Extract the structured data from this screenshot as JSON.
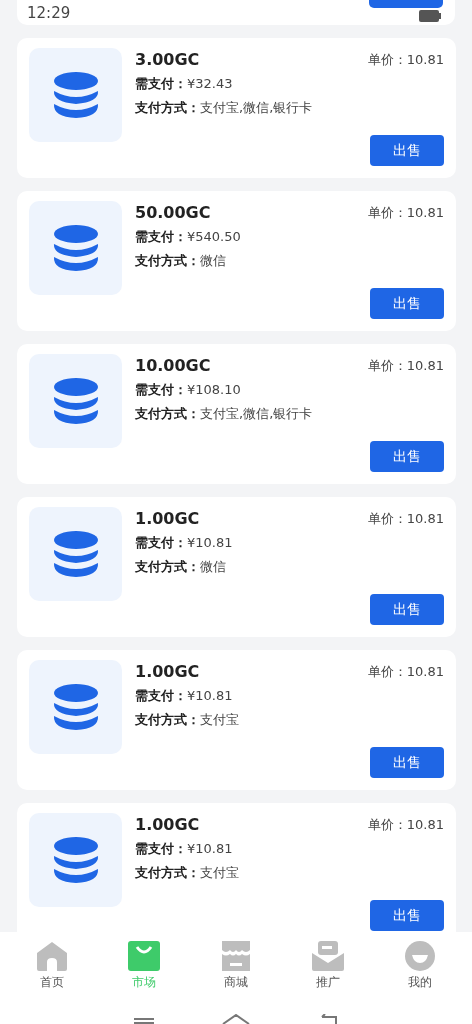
{
  "status_bar": {
    "time": "12:29"
  },
  "orders": [
    {
      "amount": "3.00GC",
      "unit_price": "单价：10.81",
      "payment": "**需支付：**¥32.43",
      "methods": "**支付方式：**支付宝,微信,银行卡",
      "button": "出售"
    },
    {
      "amount": "50.00GC",
      "unit_price": "单价：10.81",
      "payment": "**需支付：**¥540.50",
      "methods": "**支付方式：**微信",
      "button": "出售"
    },
    {
      "amount": "10.00GC",
      "unit_price": "单价：10.81",
      "payment": "**需支付：**¥108.10",
      "methods": "**支付方式：**支付宝,微信,银行卡",
      "button": "出售"
    },
    {
      "amount": "1.00GC",
      "unit_price": "单价：10.81",
      "payment": "**需支付：**¥10.81",
      "methods": "**支付方式：**微信",
      "button": "出售"
    },
    {
      "amount": "1.00GC",
      "unit_price": "单价：10.81",
      "payment": "**需支付：**¥10.81",
      "methods": "**支付方式：**支付宝",
      "button": "出售"
    },
    {
      "amount": "1.00GC",
      "unit_price": "单价：10.81",
      "payment": "**需支付：**¥10.81",
      "methods": "**支付方式：**支付宝",
      "button": "出售"
    }
  ],
  "tab_bar": [
    {
      "kind": "home",
      "label": "首页",
      "selected": false
    },
    {
      "kind": "market",
      "label": "市场",
      "selected": true
    },
    {
      "kind": "shop",
      "label": "商城",
      "selected": false
    },
    {
      "kind": "promote",
      "label": "推广",
      "selected": false
    },
    {
      "kind": "me",
      "label": "我的",
      "selected": false
    }
  ]
}
